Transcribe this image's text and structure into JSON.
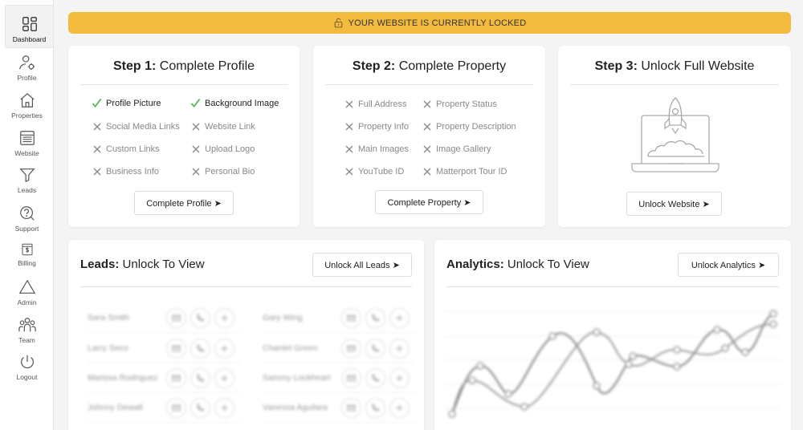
{
  "sidebar": {
    "items": [
      {
        "label": "Dashboard",
        "icon": "dashboard-icon"
      },
      {
        "label": "Profile",
        "icon": "user-gear-icon"
      },
      {
        "label": "Properties",
        "icon": "house-icon"
      },
      {
        "label": "Website",
        "icon": "website-icon"
      },
      {
        "label": "Leads",
        "icon": "funnel-icon"
      },
      {
        "label": "Support",
        "icon": "support-icon"
      },
      {
        "label": "Billing",
        "icon": "billing-icon"
      },
      {
        "label": "Admin",
        "icon": "triangle-icon"
      },
      {
        "label": "Team",
        "icon": "team-icon"
      },
      {
        "label": "Logout",
        "icon": "power-icon"
      }
    ]
  },
  "banner": {
    "text": "YOUR WEBSITE IS CURRENTLY LOCKED",
    "color": "#f2bb3d"
  },
  "step1": {
    "title_bold": "Step 1:",
    "title_rest": " Complete Profile",
    "items": [
      {
        "label": "Profile Picture",
        "done": true
      },
      {
        "label": "Background Image",
        "done": true
      },
      {
        "label": "Social Media Links",
        "done": false
      },
      {
        "label": "Website Link",
        "done": false
      },
      {
        "label": "Custom Links",
        "done": false
      },
      {
        "label": "Upload Logo",
        "done": false
      },
      {
        "label": "Business Info",
        "done": false
      },
      {
        "label": "Personal Bio",
        "done": false
      }
    ],
    "button": "Complete Profile ➤"
  },
  "step2": {
    "title_bold": "Step 2:",
    "title_rest": " Complete Property",
    "items": [
      {
        "label": "Full Address",
        "done": false
      },
      {
        "label": "Property Status",
        "done": false
      },
      {
        "label": "Property Info",
        "done": false
      },
      {
        "label": "Property Description",
        "done": false
      },
      {
        "label": "Main Images",
        "done": false
      },
      {
        "label": "Image Gallery",
        "done": false
      },
      {
        "label": "YouTube ID",
        "done": false
      },
      {
        "label": "Matterport Tour ID",
        "done": false
      }
    ],
    "button": "Complete Property ➤"
  },
  "step3": {
    "title_bold": "Step 3:",
    "title_rest": " Unlock Full Website",
    "illustration": "rocket-laptop-icon",
    "button": "Unlock Website ➤"
  },
  "leads": {
    "title_bold": "Leads:",
    "title_rest": " Unlock To View",
    "button": "Unlock All Leads ➤",
    "rows": [
      [
        "Sara Smith",
        "Gary Wing"
      ],
      [
        "Larry Seco",
        "Chantel Green"
      ],
      [
        "Marissa Rodriguez",
        "Sammy Lockheart"
      ],
      [
        "Johnny Dewalt",
        "Vanessa Aguilara"
      ]
    ]
  },
  "analytics": {
    "title_bold": "Analytics:",
    "title_rest": " Unlock To View",
    "button": "Unlock Analytics ➤"
  },
  "colors": {
    "accent": "#f2bb3d",
    "check": "#5cb85c"
  }
}
